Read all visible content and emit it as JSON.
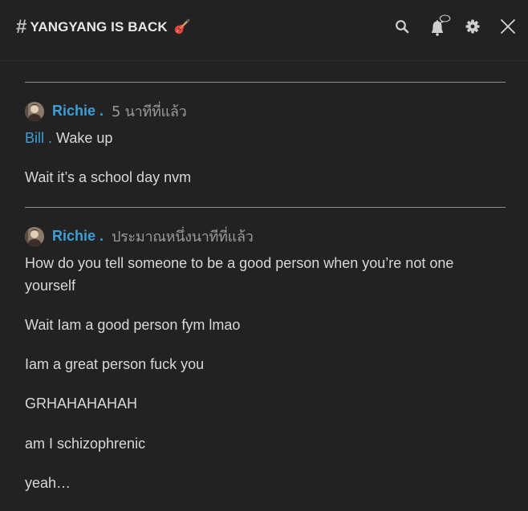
{
  "header": {
    "channel_symbol": "#",
    "channel_name": "YANGYANG IS BACK",
    "channel_emoji_icon": "guitar-icon",
    "icons": [
      "search-icon",
      "bell-icon",
      "gear-icon",
      "close-icon"
    ]
  },
  "messages": [
    {
      "author": "Richie .",
      "time": "5 นาทีที่แล้ว",
      "mention": "Bill .",
      "lines": [
        "Wake up",
        "Wait it’s a school day nvm"
      ]
    },
    {
      "author": "Richie .",
      "time": "ประมาณหนึ่งนาทีที่แล้ว",
      "lines": [
        "How do you tell someone to be a good person when you’re not one yourself",
        "Wait Iam a good person fym lmao",
        "Iam a great person fuck you",
        "GRHAHAHAHAH",
        "am I schizophrenic",
        "yeah…"
      ]
    }
  ],
  "colors": {
    "background": "#222222",
    "accent_link": "#3d9fd6",
    "text": "#d8d8d8",
    "muted": "#9a9a9a"
  }
}
